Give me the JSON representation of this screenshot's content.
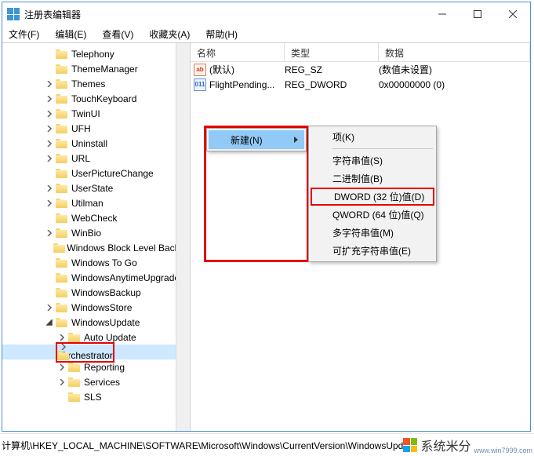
{
  "window": {
    "title": "注册表编辑器"
  },
  "menu": {
    "file": "文件(F)",
    "edit": "编辑(E)",
    "view": "查看(V)",
    "favorites": "收藏夹(A)",
    "help": "帮助(H)"
  },
  "tree": {
    "items": [
      {
        "label": "Telephony",
        "indent": 3
      },
      {
        "label": "ThemeManager",
        "indent": 3
      },
      {
        "label": "Themes",
        "indent": 3,
        "expandable": true
      },
      {
        "label": "TouchKeyboard",
        "indent": 3,
        "expandable": true
      },
      {
        "label": "TwinUI",
        "indent": 3,
        "expandable": true
      },
      {
        "label": "UFH",
        "indent": 3,
        "expandable": true
      },
      {
        "label": "Uninstall",
        "indent": 3,
        "expandable": true
      },
      {
        "label": "URL",
        "indent": 3,
        "expandable": true
      },
      {
        "label": "UserPictureChange",
        "indent": 3
      },
      {
        "label": "UserState",
        "indent": 3,
        "expandable": true
      },
      {
        "label": "Utilman",
        "indent": 3,
        "expandable": true
      },
      {
        "label": "WebCheck",
        "indent": 3
      },
      {
        "label": "WinBio",
        "indent": 3,
        "expandable": true
      },
      {
        "label": "Windows Block Level Backup",
        "indent": 3
      },
      {
        "label": "Windows To Go",
        "indent": 3
      },
      {
        "label": "WindowsAnytimeUpgrade",
        "indent": 3
      },
      {
        "label": "WindowsBackup",
        "indent": 3
      },
      {
        "label": "WindowsStore",
        "indent": 3,
        "expandable": true
      },
      {
        "label": "WindowsUpdate",
        "indent": 3,
        "expandable": true,
        "open": true
      },
      {
        "label": "Auto Update",
        "indent": 4,
        "expandable": true
      },
      {
        "label": "Orchestrator",
        "indent": 4,
        "expandable": true,
        "selected": true,
        "highlight": true
      },
      {
        "label": "Reporting",
        "indent": 4,
        "expandable": true
      },
      {
        "label": "Services",
        "indent": 4,
        "expandable": true
      },
      {
        "label": "SLS",
        "indent": 4
      }
    ]
  },
  "list": {
    "headers": {
      "name": "名称",
      "type": "类型",
      "data": "数据"
    },
    "rows": [
      {
        "icon": "str",
        "iconText": "ab",
        "name": "(默认)",
        "type": "REG_SZ",
        "data": "(数值未设置)"
      },
      {
        "icon": "bin",
        "iconText": "011",
        "name": "FlightPending...",
        "type": "REG_DWORD",
        "data": "0x00000000 (0)"
      }
    ]
  },
  "contextmenu": {
    "new": "新建(N)",
    "sub": {
      "key": "项(K)",
      "string": "字符串值(S)",
      "binary": "二进制值(B)",
      "dword": "DWORD (32 位)值(D)",
      "qword": "QWORD (64 位)值(Q)",
      "multi": "多字符串值(M)",
      "expand": "可扩充字符串值(E)"
    }
  },
  "status": {
    "path": "计算机\\HKEY_LOCAL_MACHINE\\SOFTWARE\\Microsoft\\Windows\\CurrentVersion\\WindowsUpda"
  },
  "brand": {
    "text": "系统米分",
    "url": "www.win7999.com"
  }
}
